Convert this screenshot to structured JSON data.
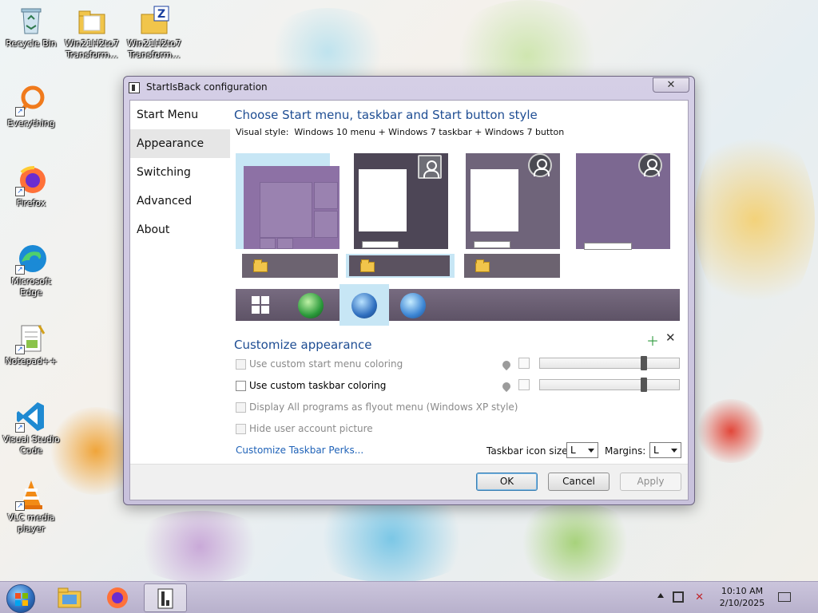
{
  "desktop": {
    "icons": [
      {
        "label": "Recycle Bin",
        "icon": "recycle-bin-icon"
      },
      {
        "label": "Win21H2to7 Transform...",
        "icon": "folder-icon"
      },
      {
        "label": "Win21H2to7 Transform...",
        "icon": "zip-archive-icon"
      },
      {
        "label": "Everything",
        "icon": "everything-search-icon"
      },
      {
        "label": "Firefox",
        "icon": "firefox-icon"
      },
      {
        "label": "Microsoft Edge",
        "icon": "edge-icon"
      },
      {
        "label": "Notepad++",
        "icon": "notepadpp-icon"
      },
      {
        "label": "Visual Studio Code",
        "icon": "vscode-icon"
      },
      {
        "label": "VLC media player",
        "icon": "vlc-icon"
      }
    ]
  },
  "dialog": {
    "title": "StartIsBack configuration",
    "close_label": "✕",
    "nav": [
      "Start Menu",
      "Appearance",
      "Switching",
      "Advanced",
      "About"
    ],
    "selected_nav": "Appearance",
    "heading": "Choose Start menu, taskbar and Start button style",
    "visual_style_label": "Visual style:",
    "visual_style_value": "Windows 10 menu + Windows 7 taskbar + Windows 7 button",
    "customize_heading": "Customize appearance",
    "options": [
      {
        "label": "Use custom start menu coloring",
        "checked": false,
        "enabled": false
      },
      {
        "label": "Use custom taskbar coloring",
        "checked": false,
        "enabled": true
      },
      {
        "label": "Display All programs as flyout menu (Windows XP style)",
        "checked": false,
        "enabled": false
      },
      {
        "label": "Hide user account picture",
        "checked": false,
        "enabled": false
      }
    ],
    "perks_link": "Customize Taskbar Perks...",
    "icon_size_label": "Taskbar icon size:",
    "icon_size_value": "L",
    "margins_label": "Margins:",
    "margins_value": "L",
    "buttons": {
      "ok": "OK",
      "cancel": "Cancel",
      "apply": "Apply"
    }
  },
  "taskbar": {
    "time": "10:10 AM",
    "date": "2/10/2025"
  },
  "colors": {
    "accent_text": "#1e4d93",
    "link": "#2063b8",
    "selection": "#c7e6f5",
    "style_purple": "#8d71a5"
  }
}
